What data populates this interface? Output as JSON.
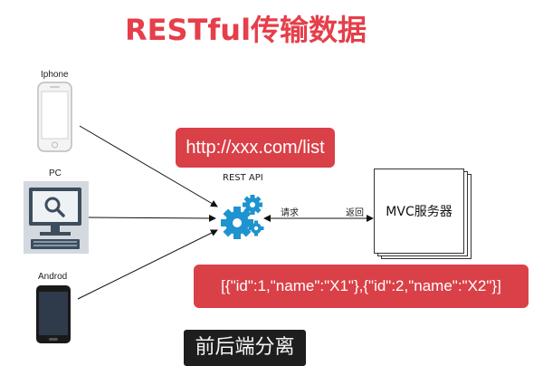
{
  "title": "RESTful传输数据",
  "devices": [
    {
      "name": "iphone",
      "label": "Iphone"
    },
    {
      "name": "pc",
      "label": "PC"
    },
    {
      "name": "android",
      "label": "Androd"
    }
  ],
  "api_label": "REST API",
  "request_url": "http://xxx.com/list",
  "response_json": "[{\"id\":1,\"name\":\"X1\"},{\"id\":2,\"name\":\"X2\"}]",
  "request_label": "请求",
  "return_label": "返回",
  "server_label": "MVC服务器",
  "caption": "前后端分离",
  "colors": {
    "title": "#e63e4a",
    "box": "#da4047",
    "gear": "#1f93cf",
    "caption_bg": "#1e1e1e"
  }
}
